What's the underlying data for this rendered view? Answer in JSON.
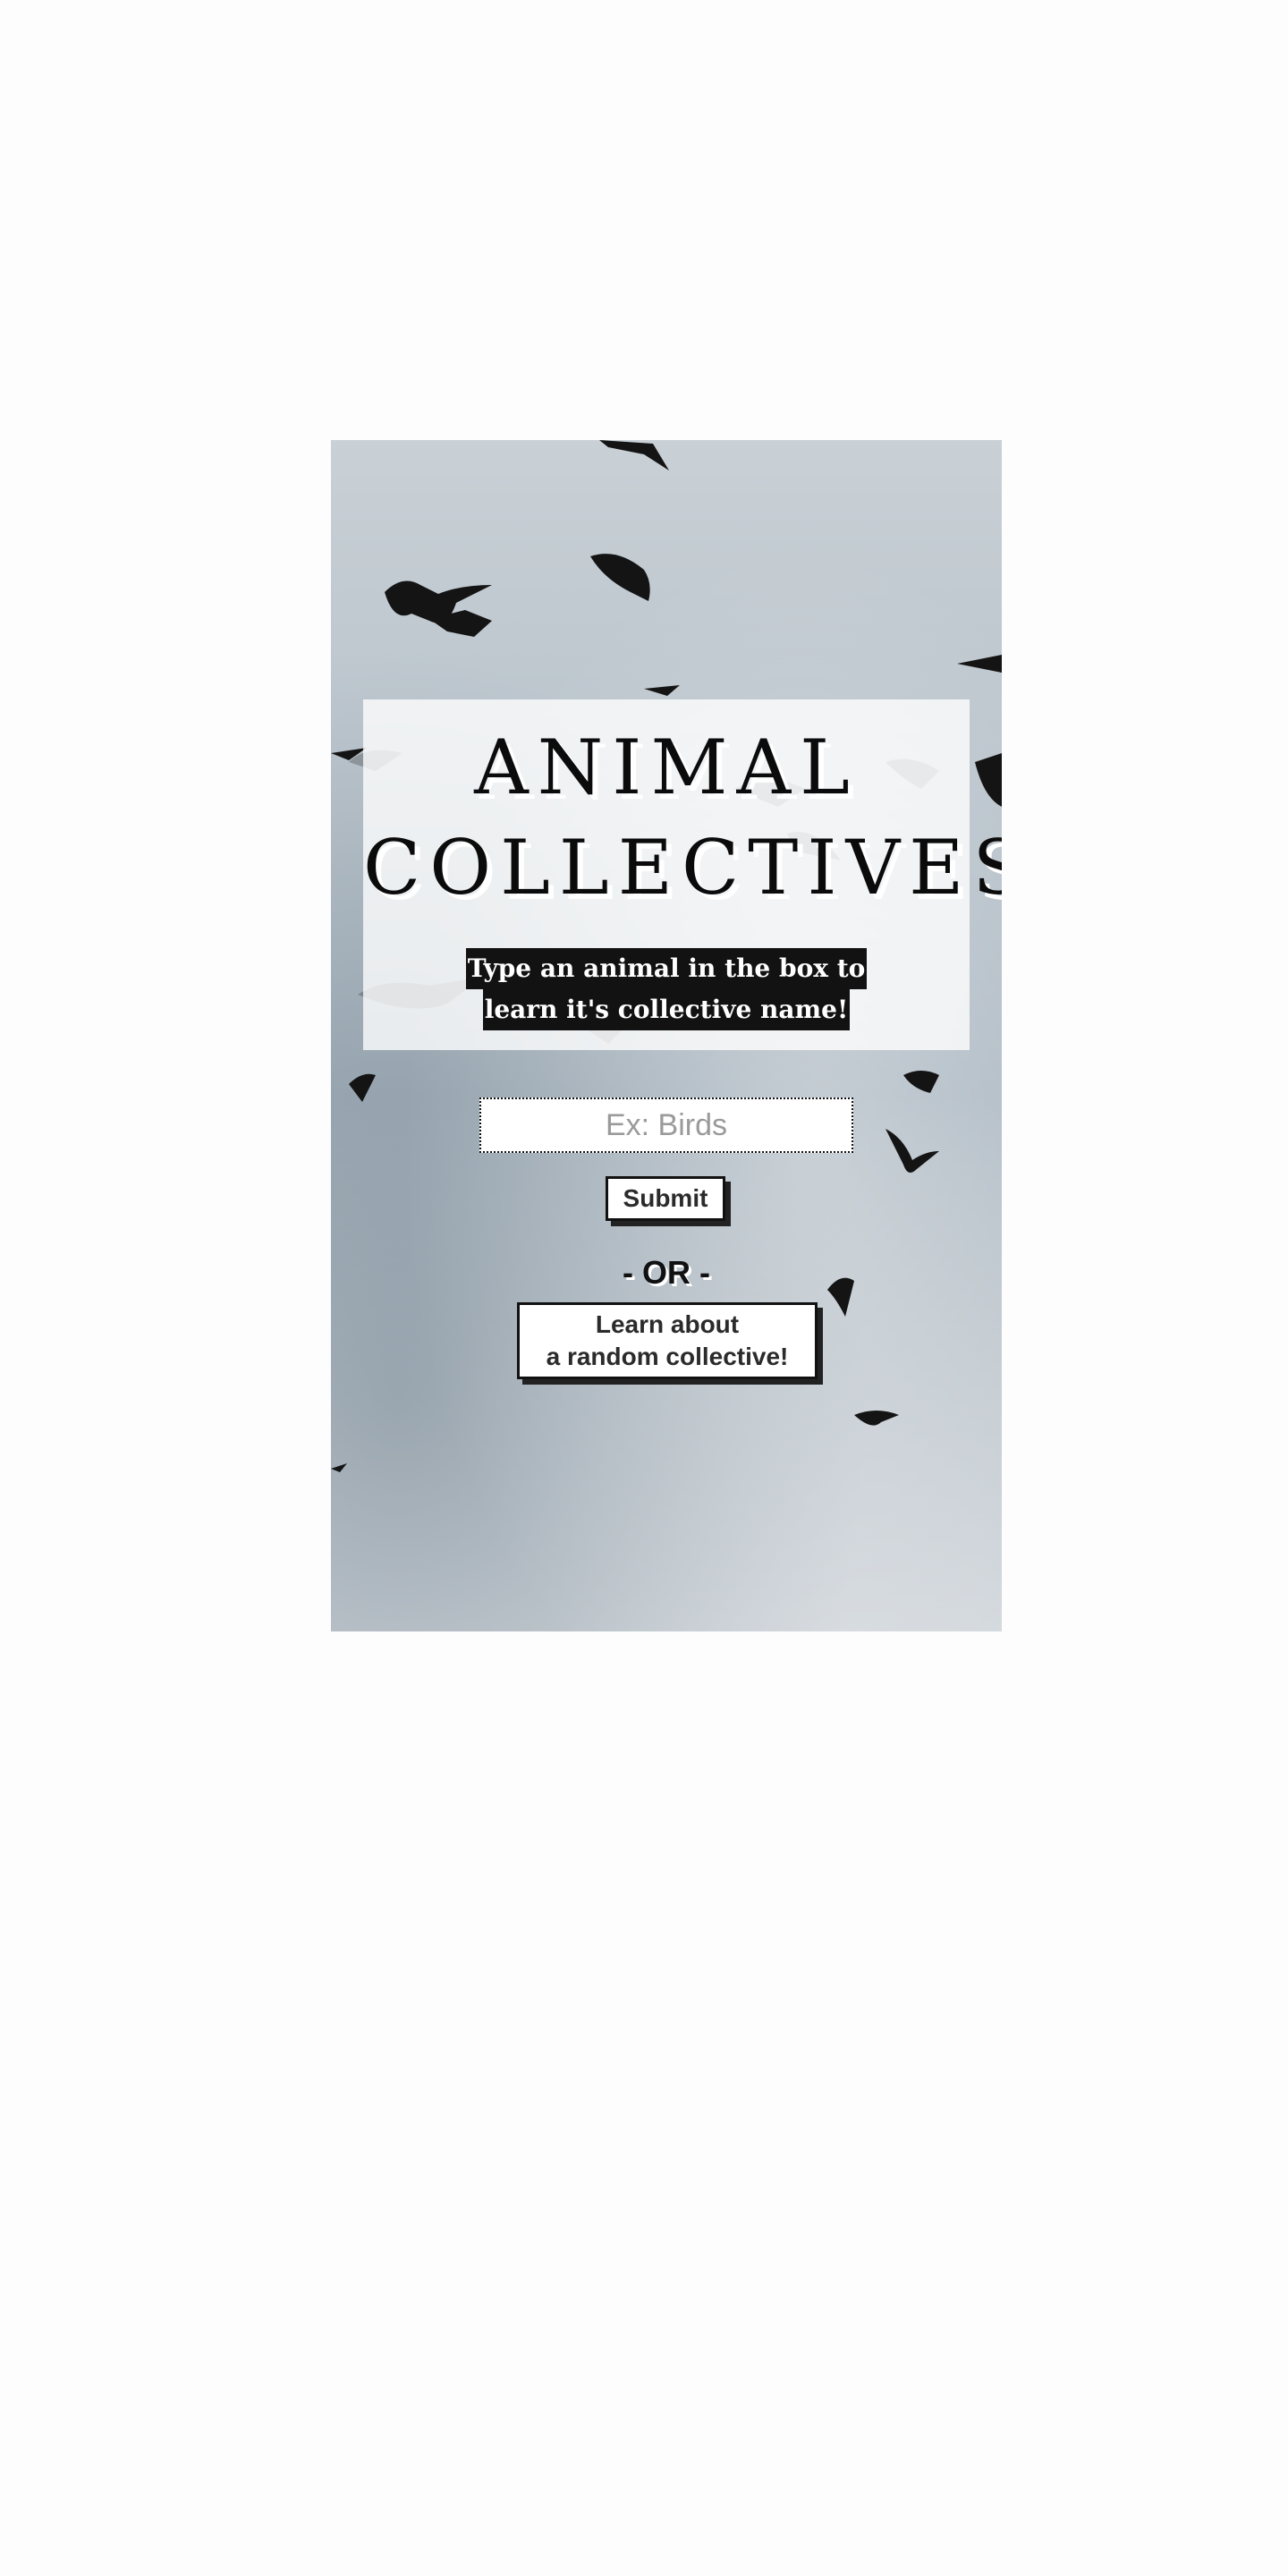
{
  "hero": {
    "title_line1": "ANIMAL",
    "title_line2": "COLLECTIVES",
    "subtitle_line1": "Type an animal in the box to",
    "subtitle_line2": "learn it's collective name!",
    "background_image": "birds-flying-sky"
  },
  "search": {
    "value": "",
    "placeholder": "Ex: Birds"
  },
  "actions": {
    "submit_label": "Submit",
    "or_label": "- OR -",
    "random_label": "Learn about\na random collective!"
  },
  "colors": {
    "page_background": "#fdfdfd",
    "sky": "#b9c3cb",
    "panel": "#ffffff",
    "text": "#0b0b0b",
    "subtitle_bg": "#121212",
    "button_shadow": "#222222"
  }
}
